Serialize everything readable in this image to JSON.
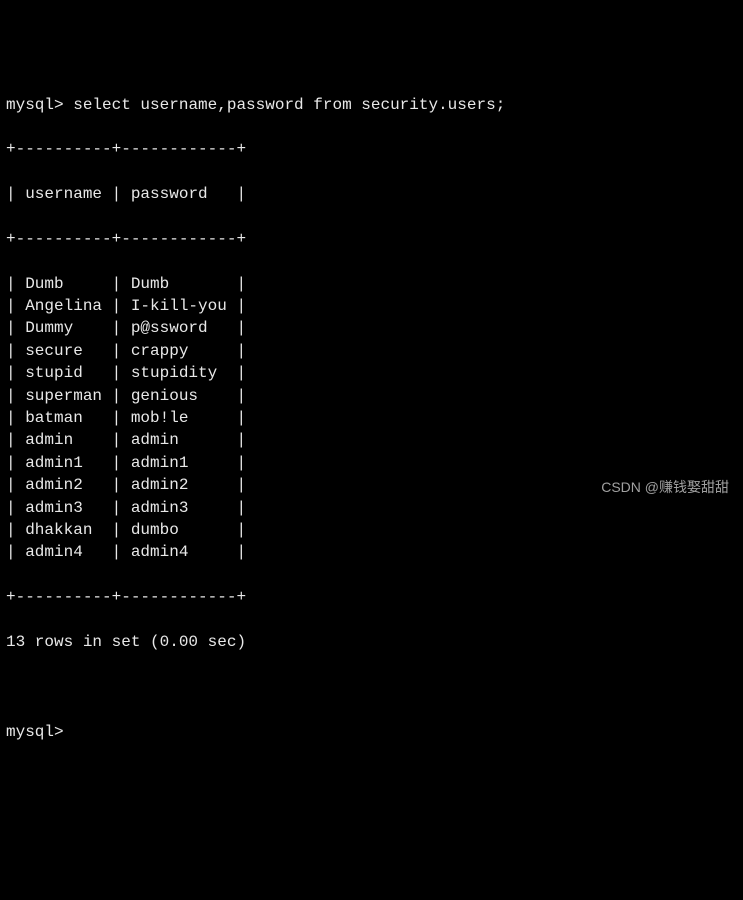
{
  "prompt1_prefix": "mysql> ",
  "query": "select username,password from security.users;",
  "columns": [
    "username",
    "password"
  ],
  "rows": [
    {
      "username": "Dumb",
      "password": "Dumb"
    },
    {
      "username": "Angelina",
      "password": "I-kill-you"
    },
    {
      "username": "Dummy",
      "password": "p@ssword"
    },
    {
      "username": "secure",
      "password": "crappy"
    },
    {
      "username": "stupid",
      "password": "stupidity"
    },
    {
      "username": "superman",
      "password": "genious"
    },
    {
      "username": "batman",
      "password": "mob!le"
    },
    {
      "username": "admin",
      "password": "admin"
    },
    {
      "username": "admin1",
      "password": "admin1"
    },
    {
      "username": "admin2",
      "password": "admin2"
    },
    {
      "username": "admin3",
      "password": "admin3"
    },
    {
      "username": "dhakkan",
      "password": "dumbo"
    },
    {
      "username": "admin4",
      "password": "admin4"
    }
  ],
  "divider": "+----------+------------+",
  "colwidths": {
    "username": 10,
    "password": 12
  },
  "summary": "13 rows in set (0.00 sec)",
  "prompt2_prefix": "mysql> ",
  "watermark": "CSDN @赚钱娶甜甜"
}
